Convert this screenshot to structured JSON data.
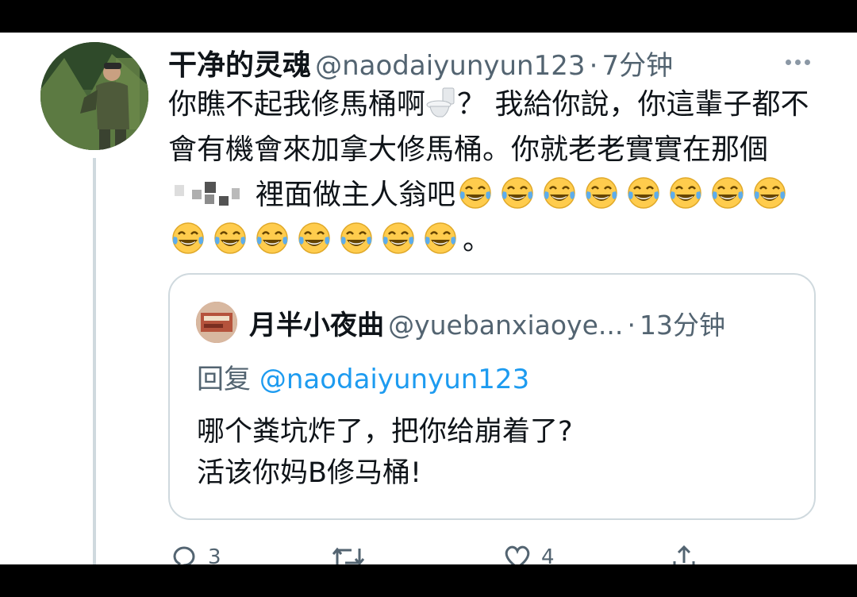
{
  "tweet": {
    "author_name": "干净的灵魂",
    "handle": "@naodaiyunyun123",
    "separator": "·",
    "time": "7分钟",
    "text_part1": "你瞧不起我修馬桶啊",
    "text_part2": "？ 我給你說，你這輩子都不會有機會來加拿大修馬桶。你就老老實實在那個",
    "text_part3": "裡面做主人翁吧",
    "text_end": "。",
    "emoji_name": "face-with-tears-of-joy",
    "emoji_count": 15
  },
  "quoted_tweet": {
    "author_name": "月半小夜曲",
    "handle": "@yuebanxiaoye...",
    "separator": "·",
    "time": "13分钟",
    "reply_prefix": "回复",
    "reply_to": "@naodaiyunyun123",
    "line1": "哪个粪坑炸了，把你给崩着了?",
    "line2": "活该你妈B修马桶!"
  },
  "actions": {
    "reply_count": "3",
    "retweet_count": "",
    "like_count": "4",
    "icons": [
      "reply-icon",
      "retweet-icon",
      "like-icon",
      "share-icon"
    ]
  },
  "colors": {
    "link": "#1d9bf0",
    "secondary_text": "#536471",
    "primary_text": "#0f1419",
    "border": "#cfd9de"
  }
}
